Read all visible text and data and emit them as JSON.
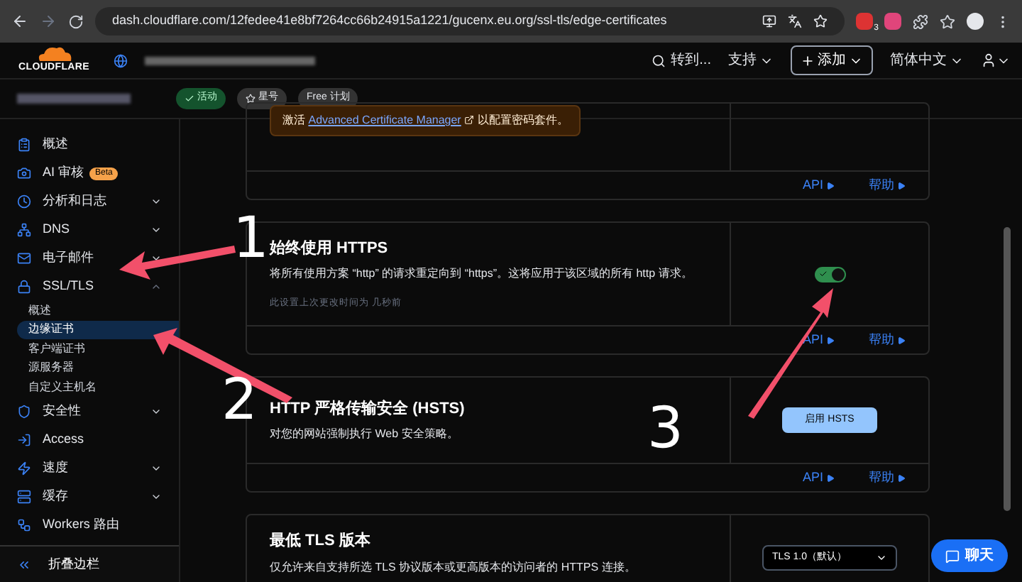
{
  "browser": {
    "url": "dash.cloudflare.com/12fedee41e8bf7264cc66b24915a1221/gucenx.eu.org/ssl-tls/edge-certificates",
    "extension_badge": "3"
  },
  "header": {
    "logo": "CLOUDFLARE",
    "goto": "转到...",
    "support": "支持",
    "add": "添加",
    "language": "简体中文"
  },
  "zone": {
    "badges": [
      {
        "kind": "active",
        "label": "活动"
      },
      {
        "kind": "star",
        "label": "星号"
      },
      {
        "kind": "plain",
        "label": "Free 计划"
      }
    ]
  },
  "sidebar": {
    "items": [
      {
        "label": "概述",
        "has_menu": false
      },
      {
        "label": "AI 审核",
        "has_menu": false,
        "badge": "Beta"
      },
      {
        "label": "分析和日志",
        "has_menu": true
      },
      {
        "label": "DNS",
        "has_menu": true
      },
      {
        "label": "电子邮件",
        "has_menu": true
      },
      {
        "label": "SSL/TLS",
        "has_menu": true,
        "expanded": true,
        "children": [
          {
            "label": "概述",
            "selected": false
          },
          {
            "label": "边缘证书",
            "selected": true
          },
          {
            "label": "客户端证书",
            "selected": false
          },
          {
            "label": "源服务器",
            "selected": false
          },
          {
            "label": "自定义主机名",
            "selected": false
          }
        ]
      },
      {
        "label": "安全性",
        "has_menu": true
      },
      {
        "label": "Access",
        "has_menu": false
      },
      {
        "label": "速度",
        "has_menu": true
      },
      {
        "label": "缓存",
        "has_menu": true
      },
      {
        "label": "Workers 路由",
        "has_menu": false
      }
    ],
    "collapse": "折叠边栏"
  },
  "cards": [
    {
      "kind": "banner",
      "banner": {
        "before": "激活",
        "link": "Advanced Certificate Manager",
        "after": "以配置密码套件。"
      },
      "footer": [
        "API",
        "帮助"
      ]
    },
    {
      "kind": "toggle",
      "title": "始终使用 HTTPS",
      "description": "将所有使用方案 “http” 的请求重定向到 “https”。这将应用于该区域的所有 http 请求。",
      "meta": "此设置上次更改时间为 几秒前",
      "on": true,
      "footer": [
        "API",
        "帮助"
      ]
    },
    {
      "kind": "button",
      "title": "HTTP 严格传输安全 (HSTS)",
      "description": "对您的网站强制执行 Web 安全策略。",
      "button": "启用 HSTS",
      "footer": [
        "API",
        "帮助"
      ]
    },
    {
      "kind": "select",
      "title": "最低 TLS 版本",
      "description": "仅允许来自支持所选 TLS 协议版本或更高版本的访问者的 HTTPS 连接。",
      "value": "TLS 1.0（默认）"
    }
  ],
  "chat": "聊天",
  "annotations": [
    "1",
    "2",
    "3"
  ]
}
